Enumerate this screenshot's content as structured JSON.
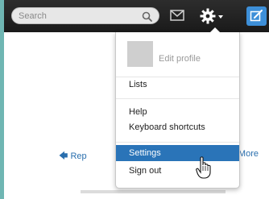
{
  "topbar": {
    "search": {
      "placeholder": "Search"
    },
    "icons": [
      "search-icon",
      "mail-icon",
      "gear-icon",
      "caret-down-icon",
      "compose-icon"
    ],
    "compose_color": "#3d8fd8"
  },
  "tweet_actions": {
    "reply_label": "Rep",
    "more_label": "More"
  },
  "dropdown": {
    "edit_profile": "Edit profile",
    "items": [
      "Lists",
      "Help",
      "Keyboard shortcuts",
      "Settings",
      "Sign out"
    ],
    "active_item": "Settings",
    "active_color": "#2a74b8"
  }
}
